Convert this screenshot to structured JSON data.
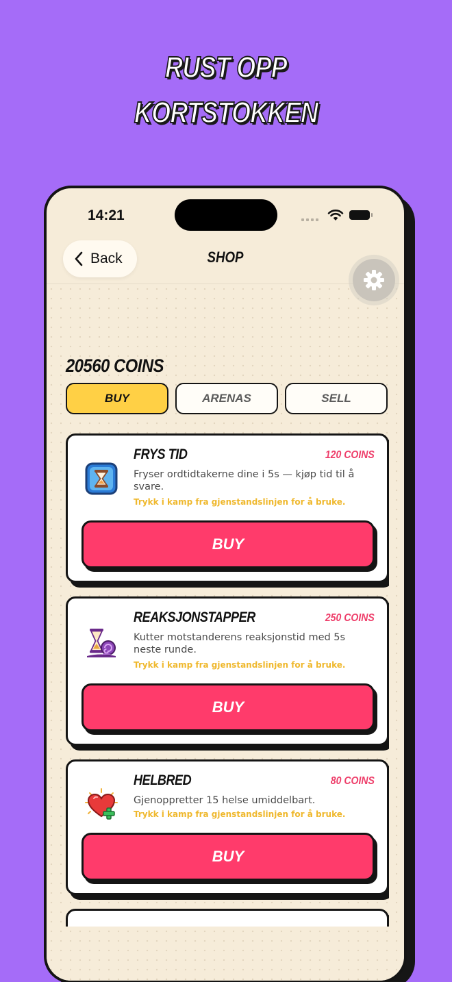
{
  "headline": {
    "line1": "Rust opp",
    "line2": "kortstokken"
  },
  "status": {
    "time": "14:21"
  },
  "nav": {
    "back_label": "Back",
    "title": "Shop"
  },
  "coins": {
    "total": "20560 COINS"
  },
  "tabs": [
    {
      "label": "Buy",
      "active": true
    },
    {
      "label": "Arenas",
      "active": false
    },
    {
      "label": "Sell",
      "active": false
    }
  ],
  "items": [
    {
      "name": "Frys tid",
      "price": "120 COINS",
      "description": "Fryser ordtidtakerne dine i 5s — kjøp tid til å svare.",
      "hint": "Trykk i kamp fra gjenstandslinjen for å bruke.",
      "buy_label": "Buy",
      "icon": "hourglass-freeze-icon"
    },
    {
      "name": "Reaksjonstapper",
      "price": "250 COINS",
      "description": "Kutter motstanderens reaksjonstid med 5s neste runde.",
      "hint": "Trykk i kamp fra gjenstandslinjen for å bruke.",
      "buy_label": "Buy",
      "icon": "hourglass-snail-icon"
    },
    {
      "name": "Helbred",
      "price": "80 COINS",
      "description": "Gjenoppretter 15 helse umiddelbart.",
      "hint": "Trykk i kamp fra gjenstandslinjen for å bruke.",
      "buy_label": "Buy",
      "icon": "heart-plus-icon"
    }
  ],
  "colors": {
    "background": "#a56cf8",
    "accent_yellow": "#ffd045",
    "buy_red": "#ff3b6b",
    "price_pink": "#ee3e6a",
    "hint_yellow": "#efb82d"
  }
}
